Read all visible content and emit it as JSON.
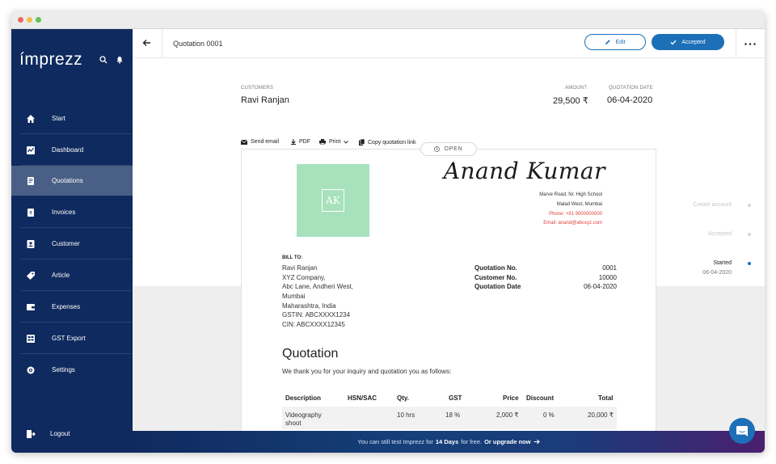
{
  "sidebar": {
    "logo": "ímprezz",
    "items": [
      {
        "label": "Start",
        "icon": "home-icon"
      },
      {
        "label": "Dashboard",
        "icon": "chart-icon"
      },
      {
        "label": "Quotations",
        "icon": "quotation-icon",
        "active": true
      },
      {
        "label": "Invoices",
        "icon": "invoice-icon"
      },
      {
        "label": "Customer",
        "icon": "customer-icon"
      },
      {
        "label": "Article",
        "icon": "tag-icon"
      },
      {
        "label": "Expenses",
        "icon": "wallet-icon"
      },
      {
        "label": "GST Export",
        "icon": "export-icon"
      },
      {
        "label": "Settings",
        "icon": "gear-icon"
      }
    ],
    "logout": "Logout"
  },
  "topbar": {
    "title": "Quotation 0001",
    "edit_label": "Edit",
    "accepted_label": "Accepted"
  },
  "summary": {
    "customers_label": "CUSTOMERS",
    "customer_name": "Ravi Ranjan",
    "amount_label": "AMOUNT",
    "amount_value": "29,500 ₹",
    "date_label": "QUOTATION DATE",
    "date_value": "06-04-2020"
  },
  "actions": {
    "send_email": "Send email",
    "pdf": "PDF",
    "print": "Print",
    "copy_link": "Copy quotation link"
  },
  "status_pill": "OPEN",
  "document": {
    "logo_initials": "AK",
    "signature_name": "Anand Kumar",
    "address_line1": "Marve Road, Nr. High School",
    "address_line2": "Malad West, Mumbai",
    "phone": "Phone: +91 9000000000",
    "email": "Email: anand@abcxyz.com",
    "bill_to_label": "BILL TO:",
    "bill_to": [
      "Ravi Ranjan",
      "XYZ Company,",
      "Abc Lane, Andheri West,",
      "Mumbai",
      "Maharashtra, India",
      "GSTIN: ABCXXXX1234",
      "CIN: ABCXXXX12345"
    ],
    "meta": [
      {
        "key": "Quotation No.",
        "value": "0001"
      },
      {
        "key": "Customer No.",
        "value": "10000"
      },
      {
        "key": "Quotation Date",
        "value": "06-04-2020"
      }
    ],
    "heading": "Quotation",
    "intro": "We thank you for your inquiry and quotation you as follows:",
    "table_headers": [
      "Description",
      "HSN/SAC",
      "Qty.",
      "GST",
      "Price",
      "Discount",
      "Total"
    ],
    "row": {
      "description_line1": "Videography",
      "description_line2": "shoot",
      "hsn": "",
      "qty": "10 hrs",
      "gst": "18 %",
      "price": "2,000 ₹",
      "discount": "0 %",
      "total": "20,000 ₹"
    }
  },
  "timeline": [
    {
      "label": "Create account",
      "date": ""
    },
    {
      "label": "Accepted",
      "date": ""
    },
    {
      "label": "Started",
      "date": "06-04-2020"
    }
  ],
  "upgrade_banner": {
    "prefix": "You can still test Imprezz for",
    "days": "14 Days",
    "middle": "for free.",
    "cta": "Or upgrade now"
  },
  "colors": {
    "sidebar": "#0f2a5e",
    "accent": "#1d6fb8",
    "logo_bg": "#a7e2bd",
    "contact_red": "#e0413a"
  }
}
